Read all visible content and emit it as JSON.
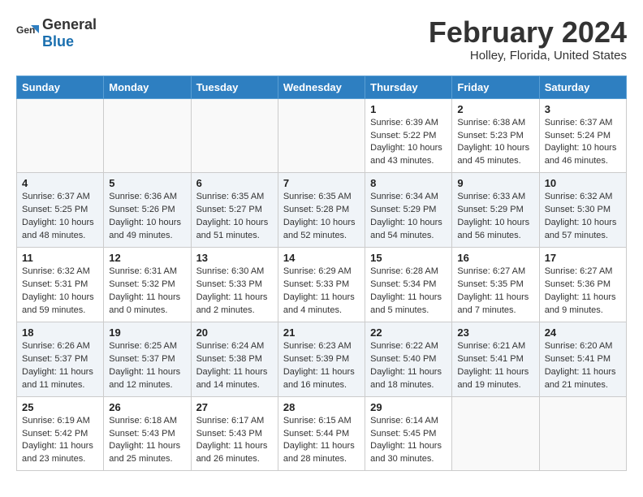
{
  "header": {
    "logo_general": "General",
    "logo_blue": "Blue",
    "main_title": "February 2024",
    "sub_title": "Holley, Florida, United States"
  },
  "weekdays": [
    "Sunday",
    "Monday",
    "Tuesday",
    "Wednesday",
    "Thursday",
    "Friday",
    "Saturday"
  ],
  "weeks": [
    {
      "shaded": false,
      "days": [
        {
          "num": "",
          "detail": ""
        },
        {
          "num": "",
          "detail": ""
        },
        {
          "num": "",
          "detail": ""
        },
        {
          "num": "",
          "detail": ""
        },
        {
          "num": "1",
          "detail": "Sunrise: 6:39 AM\nSunset: 5:22 PM\nDaylight: 10 hours and 43 minutes."
        },
        {
          "num": "2",
          "detail": "Sunrise: 6:38 AM\nSunset: 5:23 PM\nDaylight: 10 hours and 45 minutes."
        },
        {
          "num": "3",
          "detail": "Sunrise: 6:37 AM\nSunset: 5:24 PM\nDaylight: 10 hours and 46 minutes."
        }
      ]
    },
    {
      "shaded": true,
      "days": [
        {
          "num": "4",
          "detail": "Sunrise: 6:37 AM\nSunset: 5:25 PM\nDaylight: 10 hours and 48 minutes."
        },
        {
          "num": "5",
          "detail": "Sunrise: 6:36 AM\nSunset: 5:26 PM\nDaylight: 10 hours and 49 minutes."
        },
        {
          "num": "6",
          "detail": "Sunrise: 6:35 AM\nSunset: 5:27 PM\nDaylight: 10 hours and 51 minutes."
        },
        {
          "num": "7",
          "detail": "Sunrise: 6:35 AM\nSunset: 5:28 PM\nDaylight: 10 hours and 52 minutes."
        },
        {
          "num": "8",
          "detail": "Sunrise: 6:34 AM\nSunset: 5:29 PM\nDaylight: 10 hours and 54 minutes."
        },
        {
          "num": "9",
          "detail": "Sunrise: 6:33 AM\nSunset: 5:29 PM\nDaylight: 10 hours and 56 minutes."
        },
        {
          "num": "10",
          "detail": "Sunrise: 6:32 AM\nSunset: 5:30 PM\nDaylight: 10 hours and 57 minutes."
        }
      ]
    },
    {
      "shaded": false,
      "days": [
        {
          "num": "11",
          "detail": "Sunrise: 6:32 AM\nSunset: 5:31 PM\nDaylight: 10 hours and 59 minutes."
        },
        {
          "num": "12",
          "detail": "Sunrise: 6:31 AM\nSunset: 5:32 PM\nDaylight: 11 hours and 0 minutes."
        },
        {
          "num": "13",
          "detail": "Sunrise: 6:30 AM\nSunset: 5:33 PM\nDaylight: 11 hours and 2 minutes."
        },
        {
          "num": "14",
          "detail": "Sunrise: 6:29 AM\nSunset: 5:33 PM\nDaylight: 11 hours and 4 minutes."
        },
        {
          "num": "15",
          "detail": "Sunrise: 6:28 AM\nSunset: 5:34 PM\nDaylight: 11 hours and 5 minutes."
        },
        {
          "num": "16",
          "detail": "Sunrise: 6:27 AM\nSunset: 5:35 PM\nDaylight: 11 hours and 7 minutes."
        },
        {
          "num": "17",
          "detail": "Sunrise: 6:27 AM\nSunset: 5:36 PM\nDaylight: 11 hours and 9 minutes."
        }
      ]
    },
    {
      "shaded": true,
      "days": [
        {
          "num": "18",
          "detail": "Sunrise: 6:26 AM\nSunset: 5:37 PM\nDaylight: 11 hours and 11 minutes."
        },
        {
          "num": "19",
          "detail": "Sunrise: 6:25 AM\nSunset: 5:37 PM\nDaylight: 11 hours and 12 minutes."
        },
        {
          "num": "20",
          "detail": "Sunrise: 6:24 AM\nSunset: 5:38 PM\nDaylight: 11 hours and 14 minutes."
        },
        {
          "num": "21",
          "detail": "Sunrise: 6:23 AM\nSunset: 5:39 PM\nDaylight: 11 hours and 16 minutes."
        },
        {
          "num": "22",
          "detail": "Sunrise: 6:22 AM\nSunset: 5:40 PM\nDaylight: 11 hours and 18 minutes."
        },
        {
          "num": "23",
          "detail": "Sunrise: 6:21 AM\nSunset: 5:41 PM\nDaylight: 11 hours and 19 minutes."
        },
        {
          "num": "24",
          "detail": "Sunrise: 6:20 AM\nSunset: 5:41 PM\nDaylight: 11 hours and 21 minutes."
        }
      ]
    },
    {
      "shaded": false,
      "days": [
        {
          "num": "25",
          "detail": "Sunrise: 6:19 AM\nSunset: 5:42 PM\nDaylight: 11 hours and 23 minutes."
        },
        {
          "num": "26",
          "detail": "Sunrise: 6:18 AM\nSunset: 5:43 PM\nDaylight: 11 hours and 25 minutes."
        },
        {
          "num": "27",
          "detail": "Sunrise: 6:17 AM\nSunset: 5:43 PM\nDaylight: 11 hours and 26 minutes."
        },
        {
          "num": "28",
          "detail": "Sunrise: 6:15 AM\nSunset: 5:44 PM\nDaylight: 11 hours and 28 minutes."
        },
        {
          "num": "29",
          "detail": "Sunrise: 6:14 AM\nSunset: 5:45 PM\nDaylight: 11 hours and 30 minutes."
        },
        {
          "num": "",
          "detail": ""
        },
        {
          "num": "",
          "detail": ""
        }
      ]
    }
  ]
}
